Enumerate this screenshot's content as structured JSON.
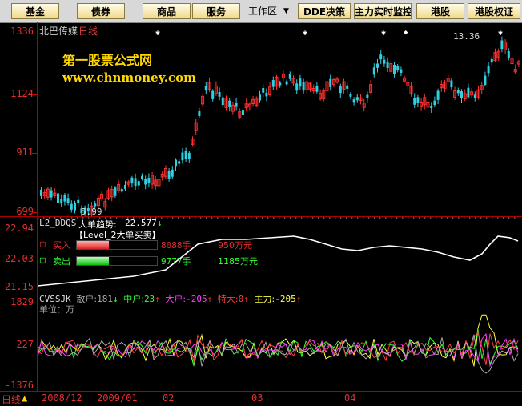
{
  "toolbar": {
    "buttons": [
      "基金",
      "债券",
      "商品",
      "服务"
    ],
    "workspace_label": "工作区",
    "workspace_arrow": "▼",
    "right_buttons": [
      "DDE决策",
      "主力实时监控",
      "港股",
      "港股权证"
    ]
  },
  "main_chart": {
    "stock_name": "北巴传媒",
    "period": "日线",
    "watermark_title": "第一股票公式网",
    "watermark_url": "www.chnmoney.com",
    "y_labels": [
      "1336",
      "1124",
      "911",
      "699"
    ],
    "high_marker": "13.36",
    "low_marker": "5.99",
    "star_symbol": "✱",
    "diamond_symbol": "◆",
    "up_color": "#ff3030",
    "down_color": "#30d0e0"
  },
  "indicator1": {
    "name": "L2_DDQS",
    "trend_label": "大单趋势:",
    "trend_value": "22.577",
    "trend_arrow": "↓",
    "panel_title": "【Level_2大单买卖】",
    "y_labels": [
      "22.94",
      "22.03",
      "21.15"
    ],
    "buy_label": "买入",
    "buy_hands": "8088手",
    "buy_amount": "950万元",
    "sell_label": "卖出",
    "sell_hands": "9777手",
    "sell_amount": "1185万元",
    "buy_ratio": 0.4,
    "sell_ratio": 0.4
  },
  "indicator2": {
    "name": "CVSSJK",
    "retail_label": "散户:",
    "retail_value": "181",
    "retail_arrow": "↓",
    "mid_label": "中户:",
    "mid_value": "23",
    "mid_arrow": "↑",
    "big_label": "大户:",
    "big_value": "-205",
    "big_arrow": "↑",
    "super_label": "特大:",
    "super_value": "0",
    "super_arrow": "↑",
    "main_label": "主力:",
    "main_value": "-205",
    "main_arrow": "↑",
    "unit_label": "单位：万",
    "y_labels": [
      "1829",
      "227",
      "-1376"
    ]
  },
  "date_axis": {
    "period_label": "日线",
    "arrow": "▲",
    "dates": [
      "2008/12",
      "2009/01",
      "02",
      "03",
      "04"
    ]
  }
}
